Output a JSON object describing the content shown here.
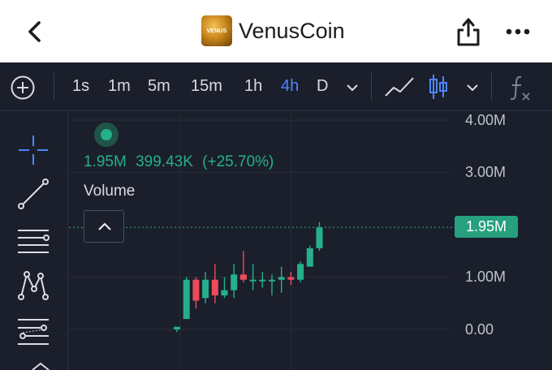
{
  "header": {
    "title": "VenusCoin",
    "logo_text": "VENUS",
    "back_icon": "chevron-left-icon",
    "share_icon": "share-icon",
    "more_icon": "more-dots-icon"
  },
  "toolbar": {
    "intervals": [
      "1s",
      "1m",
      "5m",
      "15m",
      "1h",
      "4h",
      "D"
    ],
    "active_interval": "4h",
    "icons": [
      "add-indicator-icon",
      "chevron-down-icon",
      "line-chart-icon",
      "candlestick-icon",
      "chevron-down-icon",
      "function-icon"
    ]
  },
  "drawing_tools": [
    "crosshair-icon",
    "trend-line-icon",
    "horizontal-lines-icon",
    "pattern-icon",
    "fib-tool-icon"
  ],
  "indicator": {
    "values": [
      "1.95M",
      "399.43K",
      "(+25.70%)"
    ],
    "label": "Volume"
  },
  "colors": {
    "up": "#26b089",
    "down": "#ef4a5c",
    "background": "#1b1f2b",
    "accent": "#4d86ff"
  },
  "chart_data": {
    "type": "candlestick",
    "y_axis_ticks": [
      "4.00M",
      "3.00M",
      "1.00M",
      "0.00"
    ],
    "current_value_label": "1.95M",
    "current_value": 1.95,
    "ylim": [
      -0.5,
      4.0
    ],
    "grid": true,
    "candles": [
      {
        "o": 0.0,
        "h": 0.05,
        "l": -0.05,
        "c": 0.05
      },
      {
        "o": 0.2,
        "h": 1.0,
        "l": 0.2,
        "c": 0.95
      },
      {
        "o": 0.95,
        "h": 1.0,
        "l": 0.4,
        "c": 0.55
      },
      {
        "o": 0.6,
        "h": 1.1,
        "l": 0.5,
        "c": 0.95
      },
      {
        "o": 0.95,
        "h": 1.25,
        "l": 0.5,
        "c": 0.65
      },
      {
        "o": 0.65,
        "h": 1.0,
        "l": 0.6,
        "c": 0.75
      },
      {
        "o": 0.75,
        "h": 1.25,
        "l": 0.6,
        "c": 1.05
      },
      {
        "o": 1.05,
        "h": 1.5,
        "l": 0.9,
        "c": 0.95
      },
      {
        "o": 0.95,
        "h": 1.25,
        "l": 0.75,
        "c": 0.95
      },
      {
        "o": 0.95,
        "h": 1.1,
        "l": 0.8,
        "c": 0.95
      },
      {
        "o": 0.95,
        "h": 1.05,
        "l": 0.65,
        "c": 0.95
      },
      {
        "o": 0.95,
        "h": 1.2,
        "l": 0.7,
        "c": 1.0
      },
      {
        "o": 1.0,
        "h": 1.1,
        "l": 0.85,
        "c": 0.95
      },
      {
        "o": 0.95,
        "h": 1.3,
        "l": 0.9,
        "c": 1.25
      },
      {
        "o": 1.2,
        "h": 1.6,
        "l": 1.2,
        "c": 1.55
      },
      {
        "o": 1.55,
        "h": 2.05,
        "l": 1.5,
        "c": 1.95
      }
    ]
  }
}
